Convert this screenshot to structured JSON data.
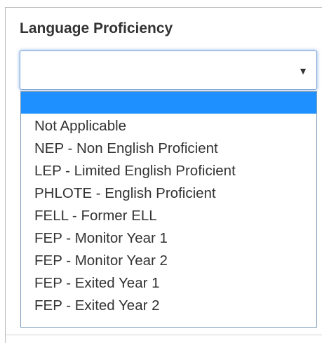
{
  "field": {
    "label": "Language Proficiency",
    "selected_value": ""
  },
  "dropdown": {
    "highlighted_index": 0,
    "options": [
      "",
      "Not Applicable",
      "NEP - Non English Proficient",
      "LEP - Limited English Proficient",
      "PHLOTE - English Proficient",
      "FELL - Former ELL",
      "FEP - Monitor Year 1",
      "FEP - Monitor Year 2",
      "FEP - Exited Year 1",
      "FEP - Exited Year 2"
    ]
  },
  "icons": {
    "caret": "chevron-down-icon"
  },
  "colors": {
    "highlight": "#1e90ff",
    "focus_border": "#7aa3d4",
    "text": "#333333"
  }
}
